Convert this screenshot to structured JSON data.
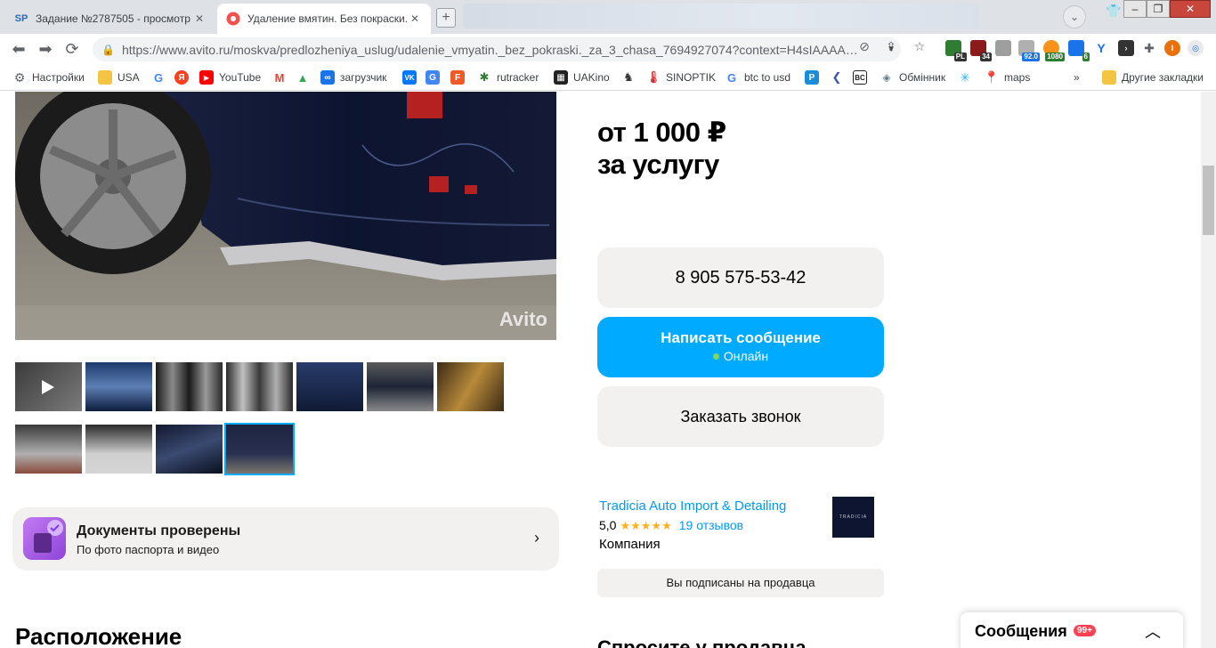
{
  "browser": {
    "tabs": [
      {
        "title": "Задание №2787505 - просмотр з…",
        "favicon": "SP"
      },
      {
        "title": "Удаление вмятин. Без покраски. З…",
        "favicon": "avito"
      }
    ],
    "new_tab": "+",
    "url": "https://www.avito.ru/moskva/predlozheniya_uslug/udalenie_vmyatin._bez_pokraski._za_3_chasa_7694927074?context=H4sIAAAA…",
    "extensions": [
      {
        "label": "PL",
        "color": "#1a73e8"
      },
      {
        "label": "34",
        "color": "#b3261e"
      },
      {
        "label": "92.0",
        "color": "#5f6368"
      },
      {
        "label": "1080",
        "color": "#e8a33d"
      },
      {
        "label": "6",
        "color": "#1a73e8"
      }
    ],
    "profile_initial": "I",
    "bookmarks": [
      {
        "label": "Настройки",
        "icon": "gear-icon",
        "color": "#5f6368"
      },
      {
        "label": "USA",
        "icon": "folder-icon",
        "color": "#f4c542"
      },
      {
        "label": "",
        "icon": "google-icon",
        "color": "#4285f4"
      },
      {
        "label": "",
        "icon": "yandex-icon",
        "color": "#fc3f1d"
      },
      {
        "label": "YouTube",
        "icon": "youtube-icon",
        "color": "#ff0000"
      },
      {
        "label": "",
        "icon": "gmail-icon",
        "color": "#ea4335"
      },
      {
        "label": "",
        "icon": "drive-icon",
        "color": "#34a853"
      },
      {
        "label": "загрузчик",
        "icon": "infinity-icon",
        "color": "#1a73e8"
      },
      {
        "label": "",
        "icon": "vk-icon",
        "color": "#0077ff"
      },
      {
        "label": "",
        "icon": "translate-icon",
        "color": "#4285f4"
      },
      {
        "label": "",
        "icon": "f-icon",
        "color": "#f05a28"
      },
      {
        "label": "rutracker",
        "icon": "rutracker-icon",
        "color": "#2e7d32"
      },
      {
        "label": "UAKino",
        "icon": "uakino-icon",
        "color": "#222222"
      },
      {
        "label": "",
        "icon": "chess-icon",
        "color": "#333333"
      },
      {
        "label": "SINOPTIK",
        "icon": "thermometer-icon",
        "color": "#d32f2f"
      },
      {
        "label": "btc to usd",
        "icon": "google-icon",
        "color": "#4285f4"
      },
      {
        "label": "",
        "icon": "p-icon",
        "color": "#1a8cd8"
      },
      {
        "label": "",
        "icon": "arrow-icon",
        "color": "#3f51b5"
      },
      {
        "label": "",
        "icon": "bc-icon",
        "color": "#222222"
      },
      {
        "label": "Обмінник",
        "icon": "exchange-icon",
        "color": "#607d8b"
      },
      {
        "label": "",
        "icon": "spark-icon",
        "color": "#29b6f6"
      },
      {
        "label": "maps",
        "icon": "maps-icon",
        "color": "#34a853"
      }
    ],
    "more_bookmarks": "»",
    "other_bookmarks": "Другие закладки"
  },
  "listing": {
    "watermark": "Avito",
    "price_line1": "от 1 000 ₽",
    "price_line2": "за услугу",
    "phone": "8 905 575-53-42",
    "message_button": "Написать сообщение",
    "online_status": "Онлайн",
    "call_button": "Заказать звонок",
    "docs_title": "Документы проверены",
    "docs_subtitle": "По фото паспорта и видео",
    "location_title": "Расположение",
    "ask_title": "Спросите у продавца"
  },
  "seller": {
    "name": "Tradicia Auto Import & Detailing",
    "rating": "5,0",
    "rating_stars": 5,
    "reviews": "19 отзывов",
    "type": "Компания",
    "logo_text": "TRADICIA",
    "subscribed_label": "Вы подписаны на продавца"
  },
  "messenger": {
    "title": "Сообщения",
    "badge": "99+"
  },
  "colors": {
    "accent_blue": "#00aaff",
    "link_blue": "#0099f7",
    "star": "#ffb021",
    "badge_red": "#ff4053",
    "card_gray": "#f2f1f0"
  }
}
